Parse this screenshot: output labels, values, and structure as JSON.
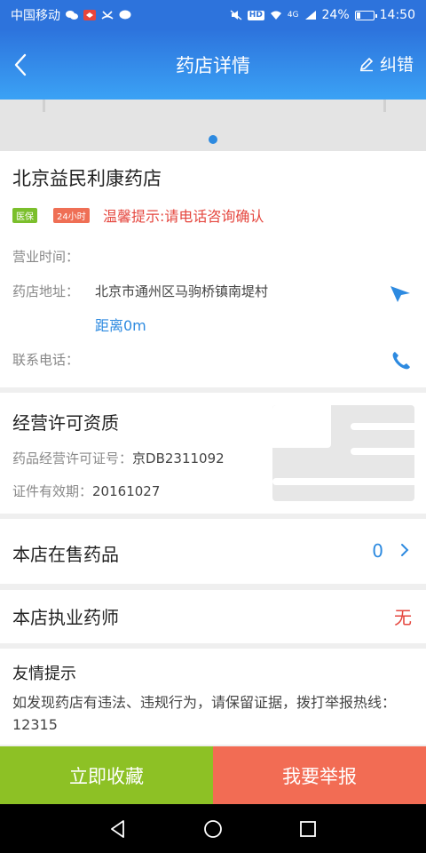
{
  "statusbar": {
    "carrier": "中国移动",
    "hd_badge": "HD",
    "network": "4G",
    "battery_text": "24%",
    "battery_level": 0.24,
    "time": "14:50"
  },
  "header": {
    "title": "药店详情",
    "correct_label": "纠错"
  },
  "store": {
    "name": "北京益民利康药店",
    "tags": [
      "医保",
      "24小时"
    ],
    "tip": "温馨提示:请电话咨询确认",
    "hours_label": "营业时间：",
    "hours_value": "",
    "address_label": "药店地址：",
    "address_value": "北京市通州区马驹桥镇南堤村",
    "distance": "距离0m",
    "phone_label": "联系电话：",
    "phone_value": ""
  },
  "license": {
    "title": "经营许可资质",
    "cert_label": "药品经营许可证号：",
    "cert_value": "京DB2311092",
    "valid_label": "证件有效期：",
    "valid_value": "20161027"
  },
  "drugs": {
    "label": "本店在售药品",
    "count": "0"
  },
  "pharmacists": {
    "label": "本店执业药师",
    "value": "无"
  },
  "notice": {
    "title": "友情提示",
    "text": "如发现药店有违法、违规行为，请保留证据，拨打举报热线：12315"
  },
  "actions": {
    "favorite": "立即收藏",
    "report": "我要举报"
  },
  "colors": {
    "primary": "#2d8ae0",
    "header_top": "#2d74dd",
    "header_bottom": "#3ba2f5",
    "warning": "#e5473f",
    "green": "#8dc125",
    "orange": "#f26c54"
  }
}
